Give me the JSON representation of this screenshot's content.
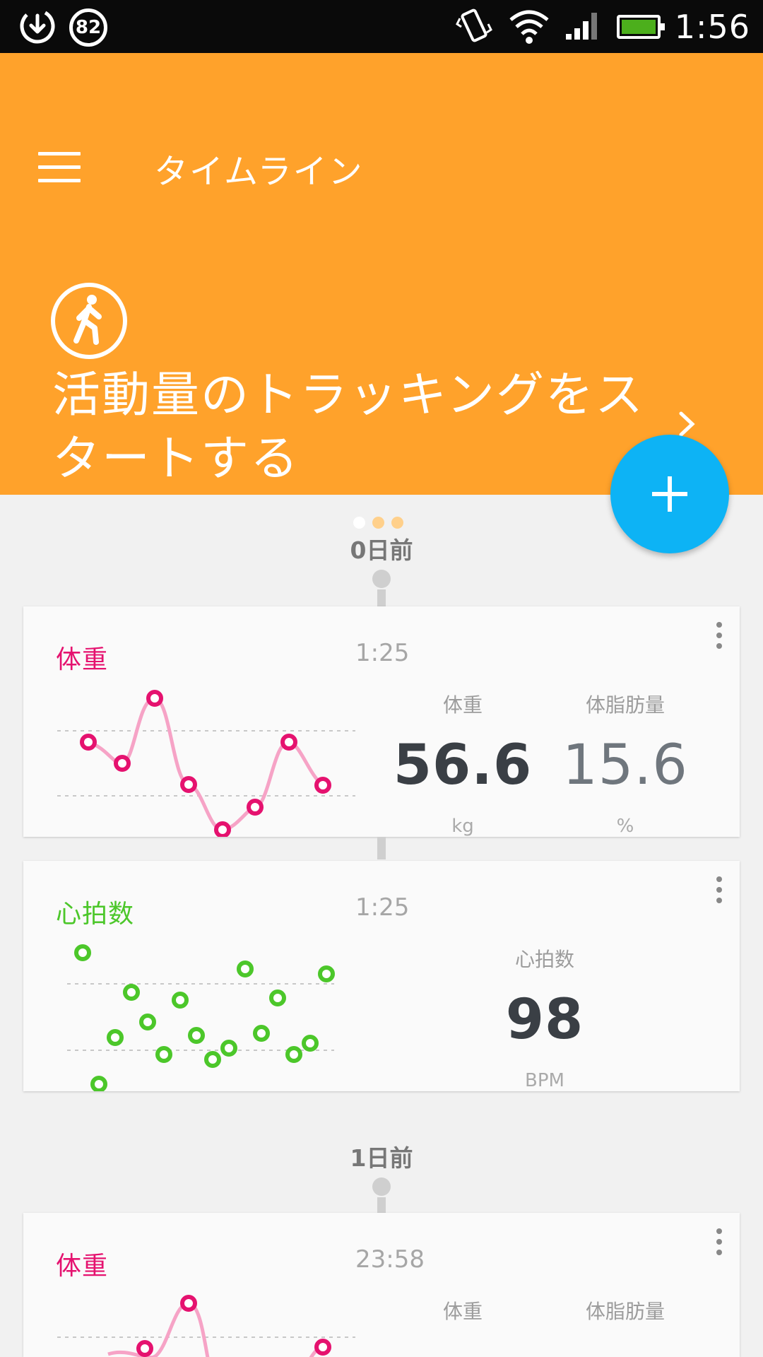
{
  "status_bar": {
    "notification_badge": "82",
    "time": "1:56",
    "icons": [
      "download-icon",
      "vibrate-icon",
      "wifi-icon",
      "signal-icon",
      "battery-icon"
    ]
  },
  "app_bar": {
    "title": "タイムライン"
  },
  "banner": {
    "text": "活動量のトラッキングをスタートする",
    "page_count": 3,
    "active_page": 1,
    "icon": "walking-person-icon",
    "color": "#ffa22b"
  },
  "fab": {
    "label": "+",
    "color": "#0db3f5"
  },
  "timeline": [
    {
      "day": "0日前",
      "cards": [
        {
          "type": "weight",
          "title": "体重",
          "title_color": "#e5126f",
          "time": "1:25",
          "stats": [
            {
              "label": "体重",
              "value": "56.6",
              "unit": "kg"
            },
            {
              "label": "体脂肪量",
              "value": "15.6",
              "unit": "%"
            }
          ]
        },
        {
          "type": "heart_rate",
          "title": "心拍数",
          "title_color": "#4cc72a",
          "time": "1:25",
          "stats": [
            {
              "label": "心拍数",
              "value": "98",
              "unit": "BPM"
            }
          ]
        }
      ]
    },
    {
      "day": "1日前",
      "cards": [
        {
          "type": "weight",
          "title": "体重",
          "title_color": "#e5126f",
          "time": "23:58",
          "stats": [
            {
              "label": "体重",
              "value": "",
              "unit": ""
            },
            {
              "label": "体脂肪量",
              "value": "",
              "unit": ""
            }
          ]
        }
      ]
    }
  ]
}
